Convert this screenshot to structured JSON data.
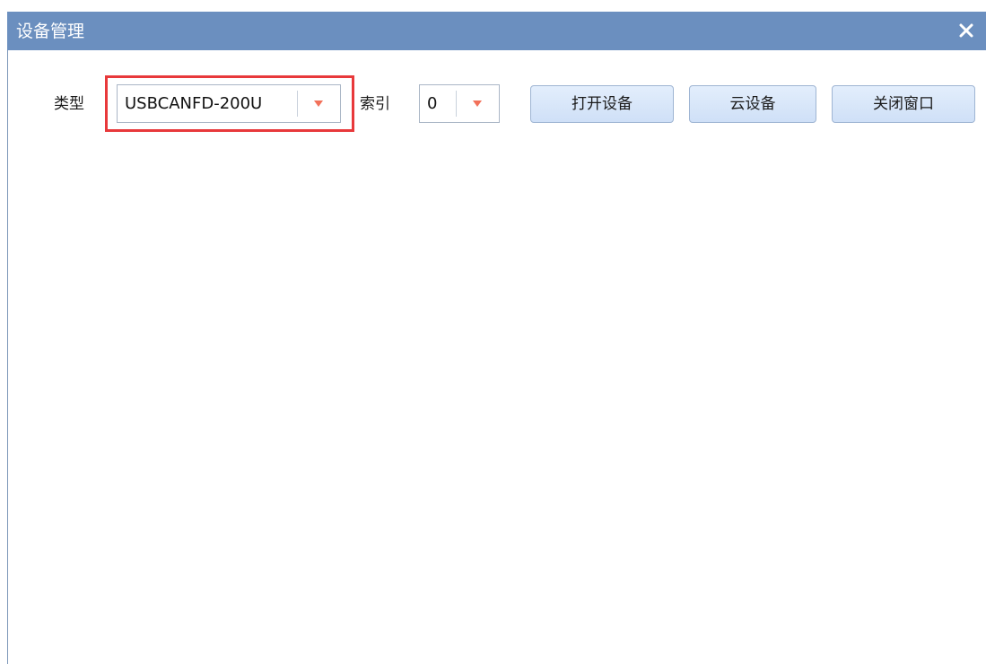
{
  "window": {
    "title": "设备管理",
    "close_icon": "close-icon",
    "titlebar_color": "#6b8fbf"
  },
  "form": {
    "type_label": "类型",
    "type_value": "USBCANFD-200U",
    "index_label": "索引",
    "index_value": "0",
    "dropdown_icon": "dropdown-arrow-icon",
    "arrow_color": "#f2715a",
    "highlight_color": "#e8393b"
  },
  "buttons": {
    "open_device": "打开设备",
    "cloud_device": "云设备",
    "close_window": "关闭窗口"
  }
}
